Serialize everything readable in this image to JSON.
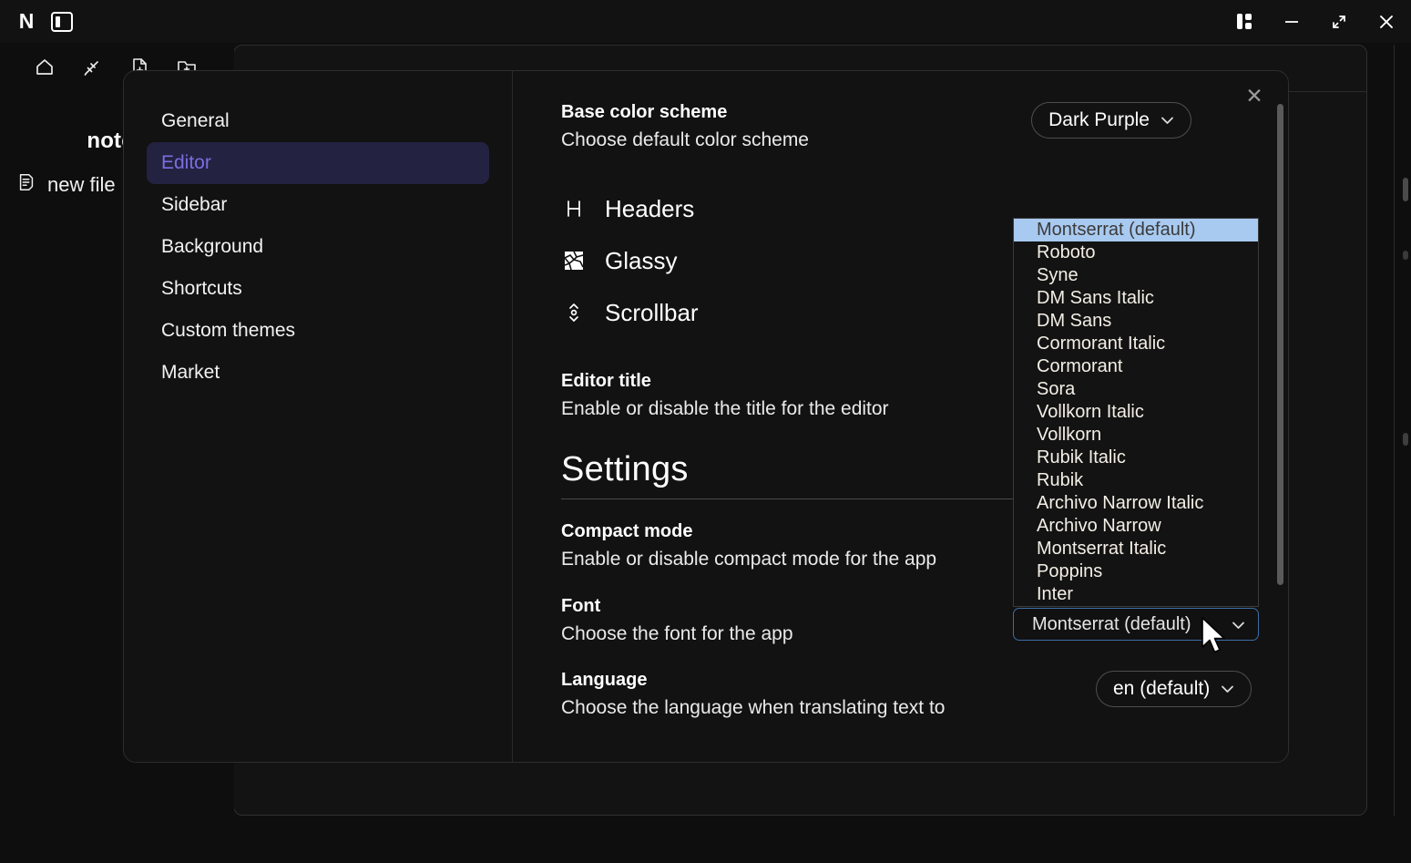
{
  "window": {
    "app_logo": "N",
    "toggle_panel_icon": "panel-toggle-icon",
    "controls": {
      "split_label": "split-view-icon",
      "minimize_label": "minimize-icon",
      "maximize_label": "maximize-icon",
      "close_label": "close-icon"
    }
  },
  "sidebar": {
    "tools": [
      {
        "name": "home-icon",
        "label": "Home"
      },
      {
        "name": "edit-icon",
        "label": "Edit"
      },
      {
        "name": "new-file-icon",
        "label": "New file"
      },
      {
        "name": "new-folder-icon",
        "label": "New folder"
      }
    ],
    "brand": "noted",
    "new_file_label": "new file"
  },
  "settings_modal": {
    "close_label": "✕",
    "nav": [
      {
        "label": "General",
        "active": false
      },
      {
        "label": "Editor",
        "active": true
      },
      {
        "label": "Sidebar",
        "active": false
      },
      {
        "label": "Background",
        "active": false
      },
      {
        "label": "Shortcuts",
        "active": false
      },
      {
        "label": "Custom themes",
        "active": false
      },
      {
        "label": "Market",
        "active": false
      }
    ],
    "color_scheme": {
      "title": "Base color scheme",
      "subtitle": "Choose default color scheme",
      "value": "Dark Purple",
      "chevron": "⌄"
    },
    "features": [
      {
        "label": "Headers",
        "icon": "headers-icon"
      },
      {
        "label": "Glassy",
        "icon": "glassy-icon"
      },
      {
        "label": "Scrollbar",
        "icon": "scrollbar-icon"
      }
    ],
    "editor_title": {
      "title": "Editor title",
      "subtitle": "Enable or disable the title for the editor"
    },
    "settings_heading": "Settings",
    "compact_mode": {
      "title": "Compact mode",
      "subtitle": "Enable or disable compact mode for the app"
    },
    "font": {
      "title": "Font",
      "subtitle": "Choose the font for the app",
      "value": "Montserrat (default)",
      "chevron": "⌄"
    },
    "language": {
      "title": "Language",
      "subtitle": "Choose the language when translating text to",
      "value": "en (default)",
      "chevron": "⌄"
    },
    "font_dropdown": {
      "open": true,
      "selected": "Montserrat (default)",
      "options": [
        "Montserrat (default)",
        "Roboto",
        "Syne",
        "DM Sans Italic",
        "DM Sans",
        "Cormorant Italic",
        "Cormorant",
        "Sora",
        "Vollkorn Italic",
        "Vollkorn",
        "Rubik Italic",
        "Rubik",
        "Archivo Narrow Italic",
        "Archivo Narrow",
        "Montserrat Italic",
        "Poppins",
        "Inter"
      ]
    }
  },
  "colors": {
    "background": "#0e0e0e",
    "panel": "#121212",
    "accent_purple": "#7d6ee0",
    "accent_purple_bg": "#232241",
    "dropdown_highlight": "#a9caf0",
    "focus_blue": "#3c6ea5",
    "border": "#2e2e2e"
  }
}
